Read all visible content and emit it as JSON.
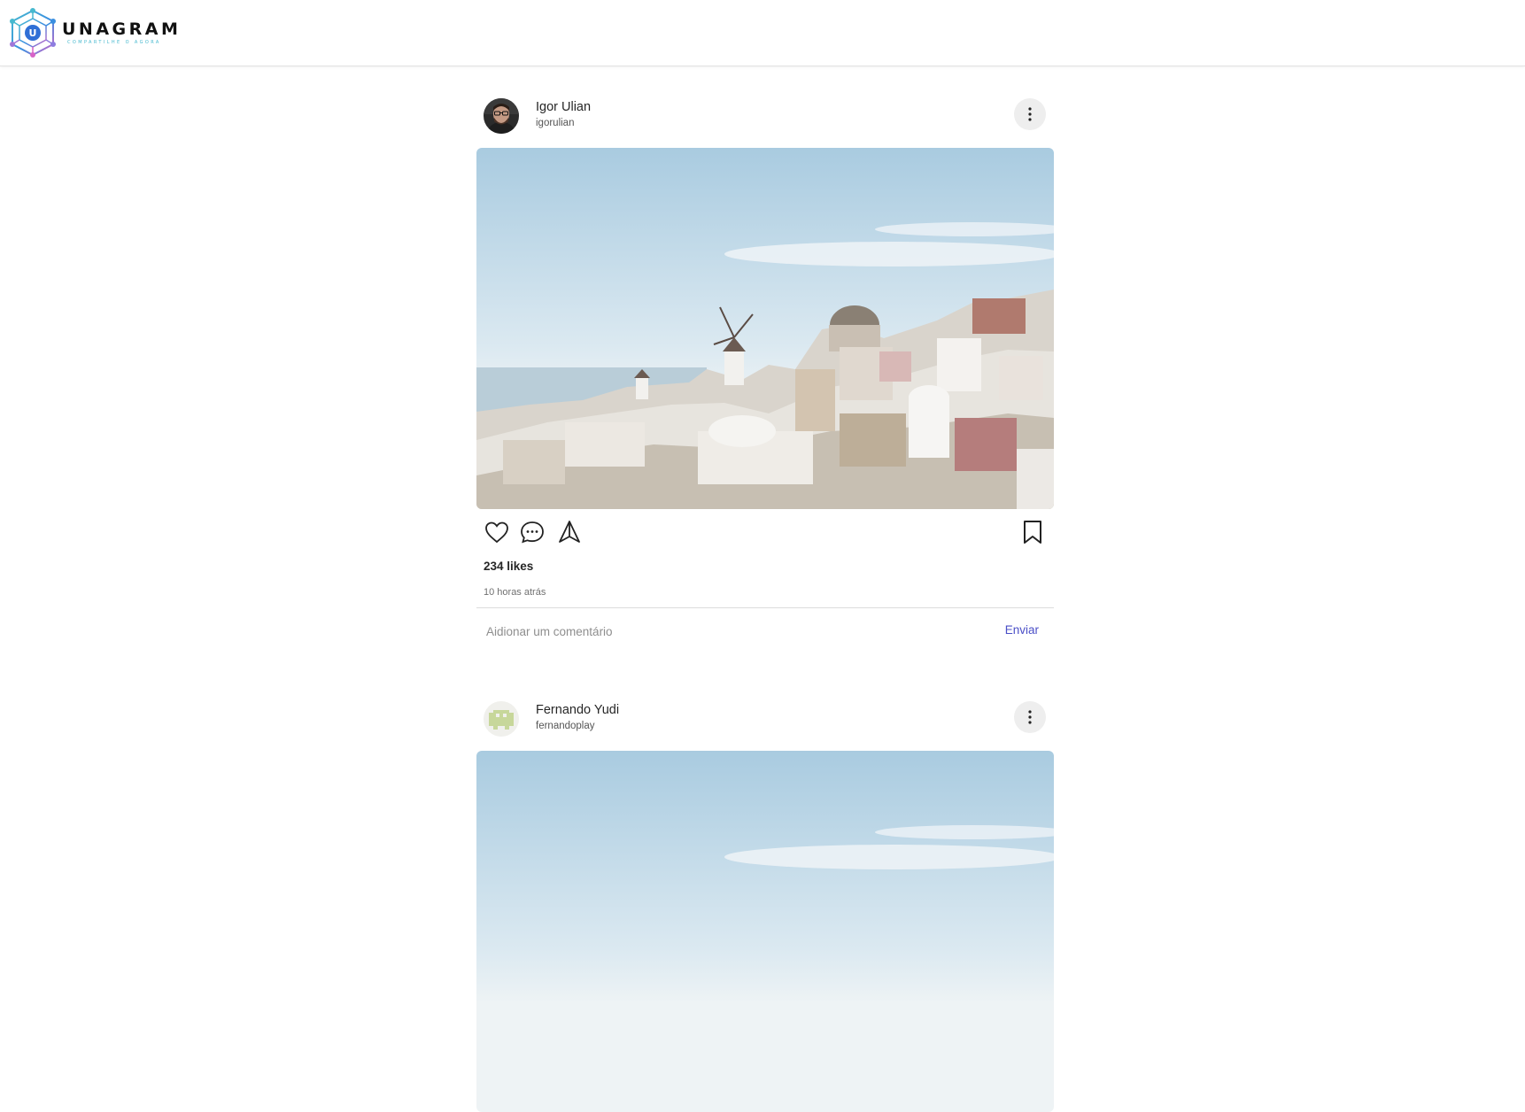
{
  "brand": {
    "name": "UNAGRAM",
    "tagline": "COMPARTILHE O AGORA",
    "mark_letter": "U",
    "colors": {
      "accent": "#4b4fc7",
      "logo_blue": "#3a8fe0",
      "logo_teal": "#47b9cf",
      "logo_pink": "#d763c7"
    }
  },
  "posts": [
    {
      "author": {
        "name": "Igor Ulian",
        "handle": "igorulian",
        "avatar": "person-photo"
      },
      "image": "santorini-village-photo",
      "likes": "234 likes",
      "time": "10 horas atrás",
      "comment": {
        "placeholder": "Aidionar um comentário",
        "send_label": "Enviar"
      }
    },
    {
      "author": {
        "name": "Fernando Yudi",
        "handle": "fernandoplay",
        "avatar": "pixel-invader-avatar"
      },
      "image": "santorini-village-photo"
    }
  ],
  "icons": {
    "more": "more-vertical-icon",
    "like": "heart-icon",
    "comment": "comment-bubble-icon",
    "share": "send-triangle-icon",
    "save": "bookmark-icon"
  }
}
